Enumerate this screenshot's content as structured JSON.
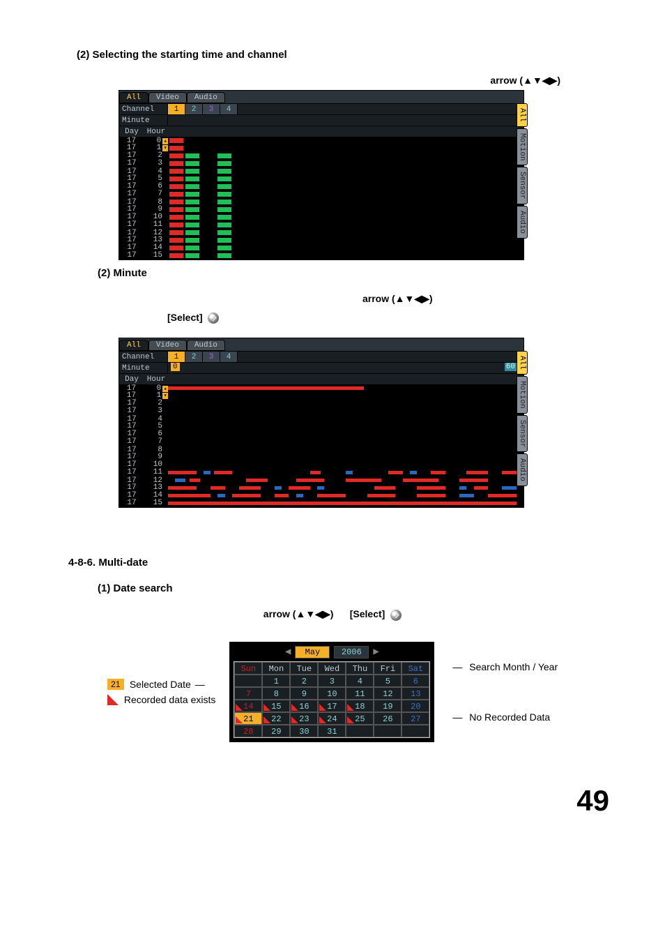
{
  "section2_heading": "(2) Selecting the starting time and channel",
  "arrow_label": "arrow (▲▼◀▶)",
  "minute_heading": "(2) Minute",
  "select_label": "[Select]",
  "section486_heading": "4-8-6. Multi-date",
  "date_search_heading": "(1) Date search",
  "panel": {
    "tabs": [
      "All",
      "Video",
      "Audio"
    ],
    "channel_label": "Channel",
    "minute_label": "Minute",
    "day_label": "Day",
    "hour_label": "Hour",
    "channels": [
      "1",
      "2",
      "3",
      "4"
    ],
    "side_tabs": [
      "All",
      "Motion",
      "Sensor",
      "Audio"
    ],
    "min0": "0",
    "min60": "60",
    "rows": [
      {
        "day": "17",
        "hour": "0"
      },
      {
        "day": "17",
        "hour": "1"
      },
      {
        "day": "17",
        "hour": "2"
      },
      {
        "day": "17",
        "hour": "3"
      },
      {
        "day": "17",
        "hour": "4"
      },
      {
        "day": "17",
        "hour": "5"
      },
      {
        "day": "17",
        "hour": "6"
      },
      {
        "day": "17",
        "hour": "7"
      },
      {
        "day": "17",
        "hour": "8"
      },
      {
        "day": "17",
        "hour": "9"
      },
      {
        "day": "17",
        "hour": "10"
      },
      {
        "day": "17",
        "hour": "11"
      },
      {
        "day": "17",
        "hour": "12"
      },
      {
        "day": "17",
        "hour": "13"
      },
      {
        "day": "17",
        "hour": "14"
      },
      {
        "day": "17",
        "hour": "15"
      }
    ],
    "panel1_bars": {
      "col1": [
        1,
        1,
        1,
        1,
        1,
        1,
        1,
        1,
        1,
        1,
        1,
        1,
        1,
        1,
        1,
        1
      ],
      "col2": [
        0,
        0,
        1,
        1,
        1,
        1,
        1,
        1,
        1,
        1,
        1,
        1,
        1,
        1,
        1,
        1
      ],
      "col4": [
        0,
        0,
        1,
        1,
        1,
        1,
        1,
        1,
        1,
        1,
        1,
        1,
        1,
        1,
        1,
        1
      ]
    },
    "panel2_segments": {
      "0": [
        {
          "c": "red",
          "l": 0,
          "w": 55
        }
      ],
      "11": [
        {
          "c": "red",
          "l": 0,
          "w": 8
        },
        {
          "c": "blue",
          "l": 10,
          "w": 2
        },
        {
          "c": "red",
          "l": 13,
          "w": 5
        },
        {
          "c": "red",
          "l": 40,
          "w": 3
        },
        {
          "c": "blue",
          "l": 50,
          "w": 2
        },
        {
          "c": "red",
          "l": 62,
          "w": 4
        },
        {
          "c": "blue",
          "l": 68,
          "w": 2
        },
        {
          "c": "red",
          "l": 74,
          "w": 4
        },
        {
          "c": "red",
          "l": 84,
          "w": 6
        },
        {
          "c": "red",
          "l": 94,
          "w": 4
        }
      ],
      "12": [
        {
          "c": "blue",
          "l": 2,
          "w": 3
        },
        {
          "c": "red",
          "l": 6,
          "w": 3
        },
        {
          "c": "red",
          "l": 22,
          "w": 6
        },
        {
          "c": "red",
          "l": 36,
          "w": 8
        },
        {
          "c": "red",
          "l": 50,
          "w": 10
        },
        {
          "c": "red",
          "l": 66,
          "w": 10
        },
        {
          "c": "red",
          "l": 82,
          "w": 8
        }
      ],
      "13": [
        {
          "c": "red",
          "l": 0,
          "w": 8
        },
        {
          "c": "red",
          "l": 12,
          "w": 4
        },
        {
          "c": "red",
          "l": 20,
          "w": 6
        },
        {
          "c": "blue",
          "l": 30,
          "w": 2
        },
        {
          "c": "red",
          "l": 34,
          "w": 6
        },
        {
          "c": "blue",
          "l": 42,
          "w": 2
        },
        {
          "c": "red",
          "l": 58,
          "w": 6
        },
        {
          "c": "red",
          "l": 70,
          "w": 8
        },
        {
          "c": "blue",
          "l": 82,
          "w": 2
        },
        {
          "c": "red",
          "l": 86,
          "w": 4
        },
        {
          "c": "blue",
          "l": 94,
          "w": 4
        }
      ],
      "14": [
        {
          "c": "red",
          "l": 0,
          "w": 12
        },
        {
          "c": "blue",
          "l": 14,
          "w": 2
        },
        {
          "c": "red",
          "l": 18,
          "w": 8
        },
        {
          "c": "red",
          "l": 30,
          "w": 4
        },
        {
          "c": "blue",
          "l": 36,
          "w": 2
        },
        {
          "c": "red",
          "l": 42,
          "w": 8
        },
        {
          "c": "red",
          "l": 56,
          "w": 8
        },
        {
          "c": "red",
          "l": 70,
          "w": 8
        },
        {
          "c": "blue",
          "l": 82,
          "w": 4
        },
        {
          "c": "red",
          "l": 90,
          "w": 8
        }
      ],
      "15": [
        {
          "c": "red",
          "l": 0,
          "w": 98
        }
      ]
    }
  },
  "calendar": {
    "search_my_label": "Search Month / Year",
    "no_data_label": "No Recorded Data",
    "selected_date_label": "Selected Date",
    "recorded_exists_label": "Recorded data exists",
    "selected_swatch": "21",
    "month": "May",
    "year": "2006",
    "weekdays": [
      "Sun",
      "Mon",
      "Tue",
      "Wed",
      "Thu",
      "Fri",
      "Sat"
    ],
    "grid": [
      [
        "",
        "1",
        "2",
        "3",
        "4",
        "5",
        "6"
      ],
      [
        "7",
        "8",
        "9",
        "10",
        "11",
        "12",
        "13"
      ],
      [
        "14",
        "15",
        "16",
        "17",
        "18",
        "19",
        "20"
      ],
      [
        "21",
        "22",
        "23",
        "24",
        "25",
        "26",
        "27"
      ],
      [
        "28",
        "29",
        "30",
        "31",
        "",
        "",
        ""
      ]
    ],
    "recorded_days": [
      "14",
      "15",
      "16",
      "17",
      "18",
      "21",
      "22",
      "23",
      "24",
      "25"
    ],
    "selected_day": "21",
    "nav_prev": "◀",
    "nav_next": "▶"
  },
  "page_number": "49"
}
